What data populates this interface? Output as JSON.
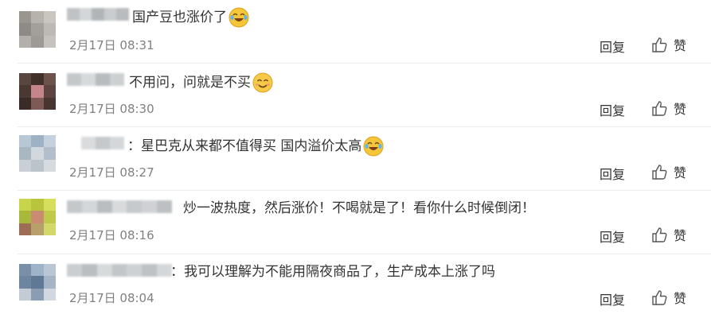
{
  "colors": {
    "text": "#333333",
    "time": "#808080",
    "divider": "#ececec",
    "background": "#ffffff"
  },
  "actions": {
    "reply_label": "回复",
    "like_label": "赞",
    "like_icon": "thumbs-up-icon"
  },
  "comments": [
    {
      "text": "国产豆也涨价了",
      "emoji": "laughing-crying-emoji",
      "time": "2月17日 08:31"
    },
    {
      "text": "不用问，问就是不买",
      "emoji": "smiling-emoji",
      "time": "2月17日 08:30"
    },
    {
      "text": "：星巴克从来都不值得买 国内溢价太高",
      "emoji": "laughing-crying-emoji",
      "time": "2月17日 08:27"
    },
    {
      "text": "炒一波热度，然后涨价！不喝就是了！看你什么时候倒闭！",
      "emoji": "",
      "time": "2月17日 08:16"
    },
    {
      "text": "：我可以理解为不能用隔夜商品了，生产成本上涨了吗",
      "emoji": "",
      "time": "2月17日 08:04"
    }
  ]
}
